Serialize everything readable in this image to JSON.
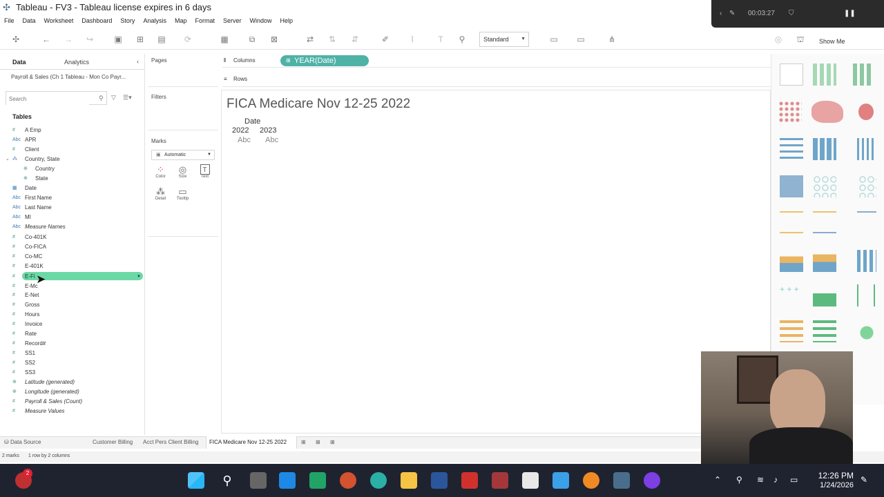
{
  "window": {
    "title": "Tableau - FV3 - Tableau license expires in 6 days"
  },
  "recorder": {
    "time": "00:03:27"
  },
  "menu": [
    "File",
    "Data",
    "Worksheet",
    "Dashboard",
    "Story",
    "Analysis",
    "Map",
    "Format",
    "Server",
    "Window",
    "Help"
  ],
  "toolbar": {
    "fit_select": "Standard",
    "show_me": "Show Me"
  },
  "data_pane": {
    "tab_data": "Data",
    "tab_analytics": "Analytics",
    "datasource": "Payroll & Sales (Ch 1 Tableau - Mon Co Payr...",
    "search_placeholder": "Search",
    "tables_label": "Tables",
    "fields": [
      {
        "icon": "#",
        "name": "A Emp"
      },
      {
        "icon": "Abc",
        "name": "APR"
      },
      {
        "icon": "#",
        "name": "Client"
      },
      {
        "icon": "⁂",
        "name": "Country, State"
      },
      {
        "icon": "⊕",
        "name": "Country"
      },
      {
        "icon": "⊕",
        "name": "State"
      },
      {
        "icon": "▦",
        "name": "Date"
      },
      {
        "icon": "Abc",
        "name": "First Name"
      },
      {
        "icon": "Abc",
        "name": "Last Name"
      },
      {
        "icon": "Abc",
        "name": "MI"
      },
      {
        "icon": "Abc",
        "name": "Measure Names"
      },
      {
        "icon": "#",
        "name": "Co-401K"
      },
      {
        "icon": "#",
        "name": "Co-FICA"
      },
      {
        "icon": "#",
        "name": "Co-MC"
      },
      {
        "icon": "#",
        "name": "E-401K"
      },
      {
        "icon": "#",
        "name": "E-Fi"
      },
      {
        "icon": "#",
        "name": "E-Mc"
      },
      {
        "icon": "#",
        "name": "E-Net"
      },
      {
        "icon": "#",
        "name": "Gross"
      },
      {
        "icon": "#",
        "name": "Hours"
      },
      {
        "icon": "#",
        "name": "Invoice"
      },
      {
        "icon": "#",
        "name": "Rate"
      },
      {
        "icon": "#",
        "name": "Record#"
      },
      {
        "icon": "#",
        "name": "SS1"
      },
      {
        "icon": "#",
        "name": "SS2"
      },
      {
        "icon": "#",
        "name": "SS3"
      },
      {
        "icon": "⊕",
        "name": "Latitude (generated)"
      },
      {
        "icon": "⊕",
        "name": "Longitude (generated)"
      },
      {
        "icon": "#",
        "name": "Payroll & Sales (Count)"
      },
      {
        "icon": "#",
        "name": "Measure Values"
      }
    ]
  },
  "cards": {
    "pages": "Pages",
    "filters": "Filters",
    "marks": "Marks",
    "marks_type": "Automatic",
    "mark_buttons": [
      "Color",
      "Size",
      "Text",
      "Detail",
      "Tooltip"
    ]
  },
  "shelves": {
    "columns": "Columns",
    "rows": "Rows",
    "column_pill": "YEAR(Date)"
  },
  "view": {
    "title": "FICA Medicare Nov 12-25 2022",
    "header": "Date",
    "years": [
      "2022",
      "2023"
    ],
    "cells": [
      "Abc",
      "Abc"
    ]
  },
  "sheet_tabs": [
    "Data Source",
    "Customer Billing",
    "Acct Pers Client Billing",
    "FICA Medicare Nov 12-25 2022"
  ],
  "status": {
    "marks": "2 marks",
    "dims": "1 row by 2 columns"
  },
  "taskbar": {
    "badge": "2",
    "time": "12:26 PM",
    "date": "1/24/2026"
  }
}
